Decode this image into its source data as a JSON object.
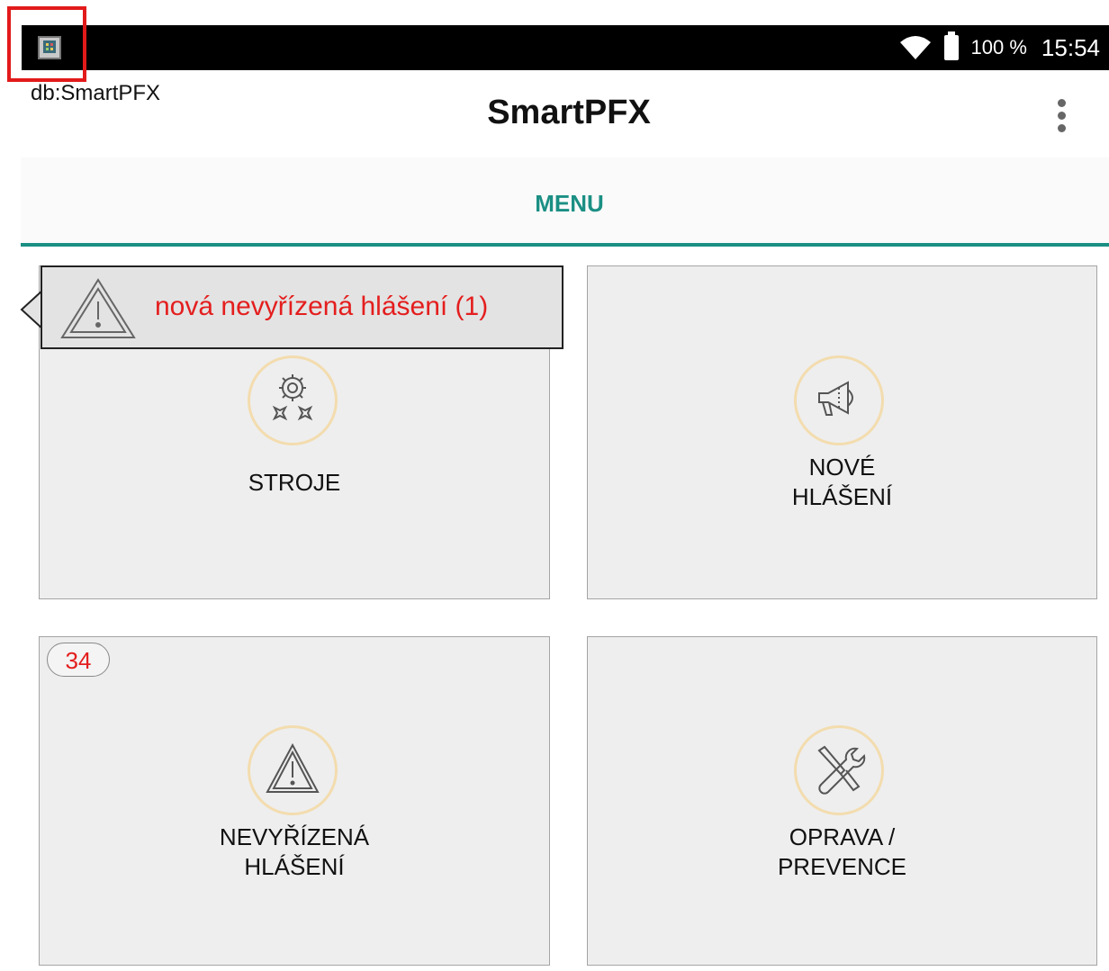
{
  "status_bar": {
    "battery": "100 %",
    "time": "15:54"
  },
  "header": {
    "db_label": "db:SmartPFX",
    "title": "SmartPFX"
  },
  "tabs": [
    {
      "label": "MENU",
      "active": true
    }
  ],
  "tiles": [
    {
      "label": "STROJE",
      "icon": "gears-icon"
    },
    {
      "label_line1": "NOVÉ",
      "label_line2": "HLÁŠENÍ",
      "icon": "megaphone-icon"
    },
    {
      "label_line1": "NEVYŘÍZENÁ",
      "label_line2": "HLÁŠENÍ",
      "icon": "warning-icon",
      "badge": "34"
    },
    {
      "label_line1": "OPRAVA /",
      "label_line2": "PREVENCE",
      "icon": "tools-icon"
    }
  ],
  "tooltip": {
    "text": "nová nevyřízená hlášení (1)",
    "icon": "warning-icon"
  },
  "colors": {
    "accent": "#1b8f84",
    "alert": "#e41e1e",
    "tile_bg": "#eeeeee",
    "icon_ring": "#f3dcae"
  }
}
